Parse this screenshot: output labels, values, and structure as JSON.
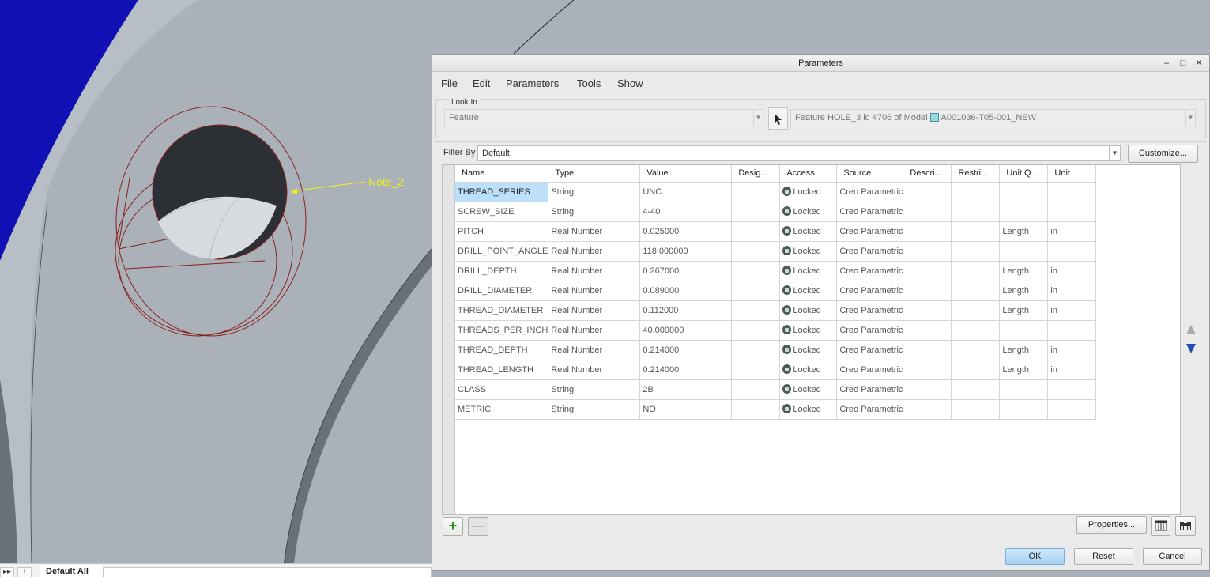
{
  "viewport": {
    "note_label": "Note_2"
  },
  "tabbar": {
    "expand_label": "▸▸",
    "add_label": "+",
    "tab_label": "Default All"
  },
  "dialog": {
    "title": "Parameters",
    "window_buttons": {
      "minimize": "–",
      "maximize": "□",
      "close": "✕"
    },
    "menu": [
      "File",
      "Edit",
      "Parameters",
      "Tools",
      "Show"
    ],
    "look_in": {
      "legend": "Look In",
      "type_value": "Feature",
      "object_prefix": "Feature HOLE_3 id 4706 of Model",
      "object_model": "A001036-T05-001_NEW"
    },
    "filter": {
      "label": "Filter By",
      "value": "Default",
      "customize_label": "Customize..."
    },
    "table": {
      "columns": [
        "Name",
        "Type",
        "Value",
        "Desig...",
        "Access",
        "Source",
        "Descri...",
        "Restri...",
        "Unit Q...",
        "Unit"
      ],
      "rows": [
        [
          "THREAD_SERIES",
          "String",
          "UNC",
          "",
          "Locked",
          "Creo Parametric",
          "",
          "",
          "",
          ""
        ],
        [
          "SCREW_SIZE",
          "String",
          "4-40",
          "",
          "Locked",
          "Creo Parametric",
          "",
          "",
          "",
          ""
        ],
        [
          "PITCH",
          "Real Number",
          "0.025000",
          "",
          "Locked",
          "Creo Parametric",
          "",
          "",
          "Length",
          "in"
        ],
        [
          "DRILL_POINT_ANGLE",
          "Real Number",
          "118.000000",
          "",
          "Locked",
          "Creo Parametric",
          "",
          "",
          "",
          ""
        ],
        [
          "DRILL_DEPTH",
          "Real Number",
          "0.267000",
          "",
          "Locked",
          "Creo Parametric",
          "",
          "",
          "Length",
          "in"
        ],
        [
          "DRILL_DIAMETER",
          "Real Number",
          "0.089000",
          "",
          "Locked",
          "Creo Parametric",
          "",
          "",
          "Length",
          "in"
        ],
        [
          "THREAD_DIAMETER",
          "Real Number",
          "0.112000",
          "",
          "Locked",
          "Creo Parametric",
          "",
          "",
          "Length",
          "in"
        ],
        [
          "THREADS_PER_INCH",
          "Real Number",
          "40.000000",
          "",
          "Locked",
          "Creo Parametric",
          "",
          "",
          "",
          ""
        ],
        [
          "THREAD_DEPTH",
          "Real Number",
          "0.214000",
          "",
          "Locked",
          "Creo Parametric",
          "",
          "",
          "Length",
          "in"
        ],
        [
          "THREAD_LENGTH",
          "Real Number",
          "0.214000",
          "",
          "Locked",
          "Creo Parametric",
          "",
          "",
          "Length",
          "in"
        ],
        [
          "CLASS",
          "String",
          "2B",
          "",
          "Locked",
          "Creo Parametric",
          "",
          "",
          "",
          ""
        ],
        [
          "METRIC",
          "String",
          "NO",
          "",
          "Locked",
          "Creo Parametric",
          "",
          "",
          "",
          ""
        ]
      ]
    },
    "toolbar": {
      "add_label": "+",
      "remove_label": "—",
      "properties_label": "Properties..."
    },
    "buttons": {
      "ok": "OK",
      "reset": "Reset",
      "cancel": "Cancel"
    },
    "colors": {
      "selected_row": "#bde0fa",
      "ok_button": "#a7d1f2",
      "add_icon": "#1a9a1a"
    }
  }
}
